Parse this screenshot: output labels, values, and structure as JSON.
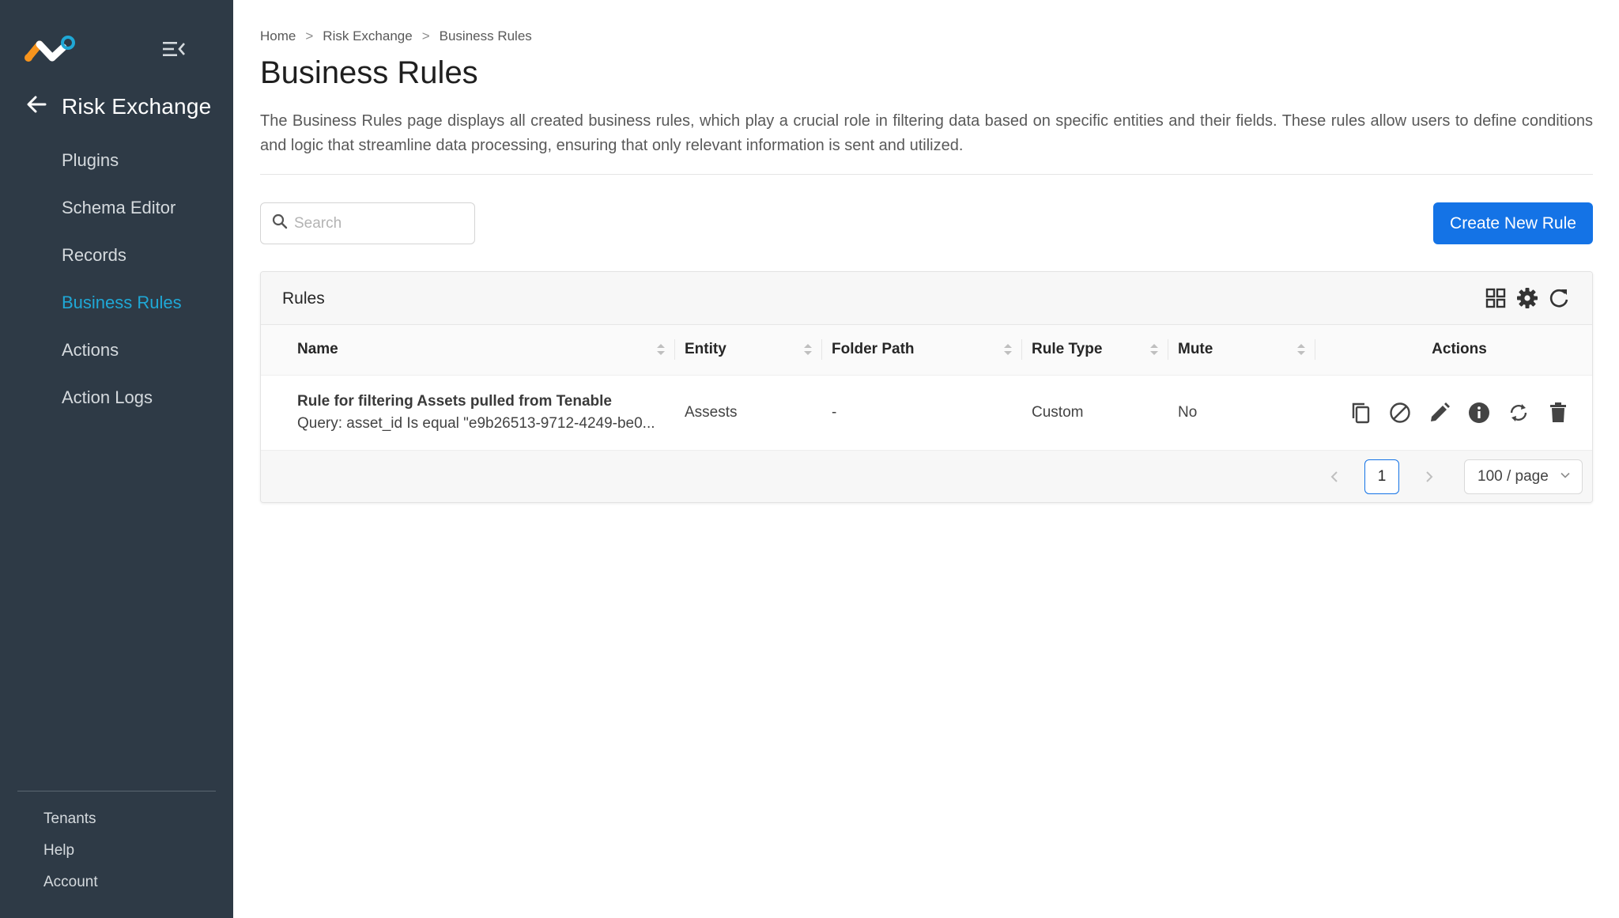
{
  "sidebar": {
    "app_title": "Risk Exchange",
    "nav_items": [
      {
        "label": "Plugins",
        "active": false
      },
      {
        "label": "Schema Editor",
        "active": false
      },
      {
        "label": "Records",
        "active": false
      },
      {
        "label": "Business Rules",
        "active": true
      },
      {
        "label": "Actions",
        "active": false
      },
      {
        "label": "Action Logs",
        "active": false
      }
    ],
    "bottom_items": [
      {
        "label": "Tenants"
      },
      {
        "label": "Help"
      },
      {
        "label": "Account"
      }
    ]
  },
  "breadcrumb": {
    "items": [
      "Home",
      "Risk Exchange",
      "Business Rules"
    ],
    "separator": ">"
  },
  "page": {
    "title": "Business Rules",
    "description": "The Business Rules page displays all created business rules, which play a crucial role in filtering data based on specific entities and their fields. These rules allow users to define conditions and logic that streamline data processing, ensuring that only relevant information is sent and utilized."
  },
  "search": {
    "placeholder": "Search",
    "value": ""
  },
  "create_button": {
    "label": "Create New Rule"
  },
  "table": {
    "title": "Rules",
    "columns": [
      "Name",
      "Entity",
      "Folder Path",
      "Rule Type",
      "Mute",
      "Actions"
    ],
    "rows": [
      {
        "name": "Rule for filtering Assets pulled from Tenable",
        "query": "Query: asset_id Is equal \"e9b26513-9712-4249-be0...",
        "entity": "Assests",
        "folder_path": "-",
        "rule_type": "Custom",
        "mute": "No"
      }
    ]
  },
  "pagination": {
    "current_page": "1",
    "page_size": "100 / page"
  },
  "colors": {
    "sidebar_bg": "#2e3a46",
    "active_nav": "#1fa8d6",
    "primary": "#1473e6",
    "logo_orange": "#f7941d",
    "logo_blue": "#1fa8d6"
  },
  "icons": {
    "toolbar": [
      "grid-icon",
      "gear-icon",
      "refresh-icon"
    ],
    "row_actions": [
      "copy-icon",
      "mute-icon",
      "edit-icon",
      "info-icon",
      "sync-icon",
      "delete-icon"
    ]
  }
}
